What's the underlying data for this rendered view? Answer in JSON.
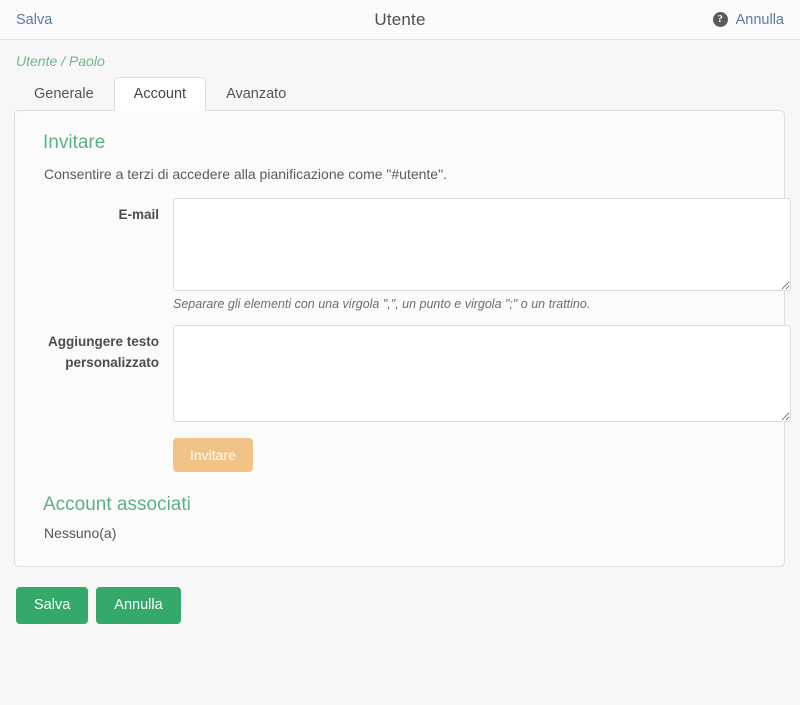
{
  "topbar": {
    "save_label": "Salva",
    "title": "Utente",
    "help_icon": "help-circle-icon",
    "help_glyph": "?",
    "cancel_label": "Annulla"
  },
  "breadcrumb": {
    "text": "Utente / Paolo"
  },
  "tabs": [
    {
      "label": "Generale",
      "active": false
    },
    {
      "label": "Account",
      "active": true
    },
    {
      "label": "Avanzato",
      "active": false
    }
  ],
  "panel": {
    "invite": {
      "title": "Invitare",
      "description": "Consentire a terzi di accedere alla pianificazione come \"#utente\".",
      "email": {
        "label": "E-mail",
        "value": "",
        "placeholder": "",
        "hint": "Separare gli elementi con una virgola \",\", un punto e virgola \";\" o un trattino."
      },
      "custom_text": {
        "label": "Aggiungere testo personalizzato",
        "value": "",
        "placeholder": ""
      },
      "invite_button": "Invitare"
    },
    "associated": {
      "title": "Account associati",
      "value": "Nessuno(a)"
    }
  },
  "footer": {
    "save_label": "Salva",
    "cancel_label": "Annulla"
  },
  "colors": {
    "accent_green": "#5fb085",
    "button_green": "#35a86b",
    "button_orange": "#f2c387",
    "link_blue": "#5b7c9d",
    "page_background": "#f7f7f7"
  }
}
